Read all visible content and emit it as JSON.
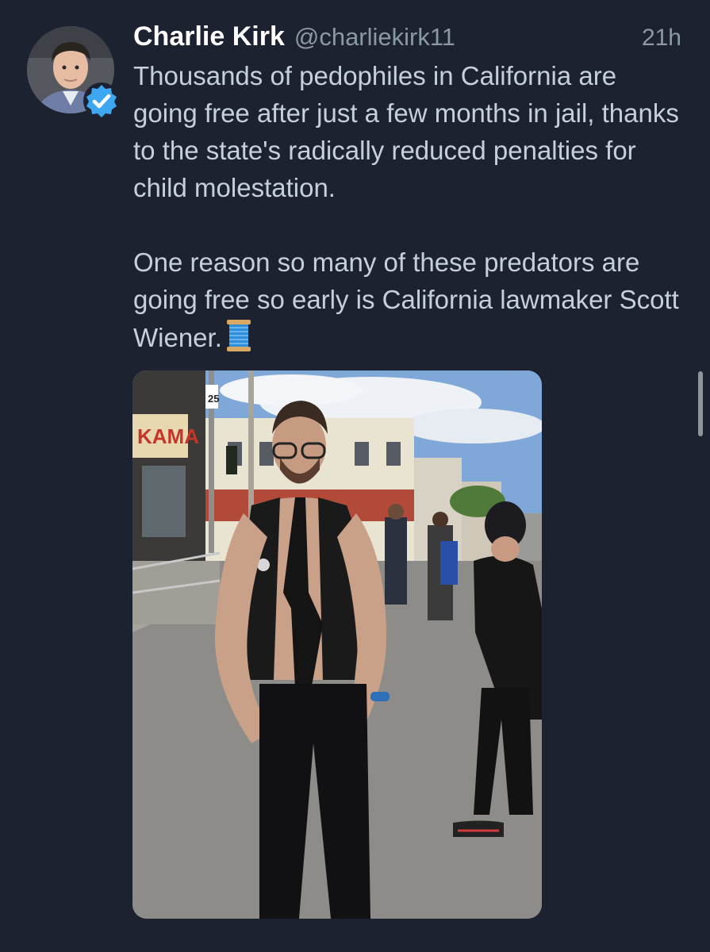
{
  "tweet": {
    "author_name": "Charlie Kirk",
    "author_handle": "@charliekirk11",
    "timestamp": "21h",
    "paragraph_1": "Thousands of pedophiles in California are going free after just a few months in jail, thanks to the state's radically reduced penalties for child molestation.",
    "paragraph_2": "One reason so many of these predators are going free so early is California lawmaker Scott Wiener.",
    "thread_emoji": "spool-of-thread-icon",
    "verified_badge": "verified-badge-icon"
  },
  "photo": {
    "signage": [
      "KAMA",
      "25"
    ]
  },
  "colors": {
    "background": "#1c2230",
    "name": "#ffffff",
    "secondary_text": "#8b98a5",
    "body_text": "#c5d0dc",
    "verified": "#1d9bf0"
  }
}
